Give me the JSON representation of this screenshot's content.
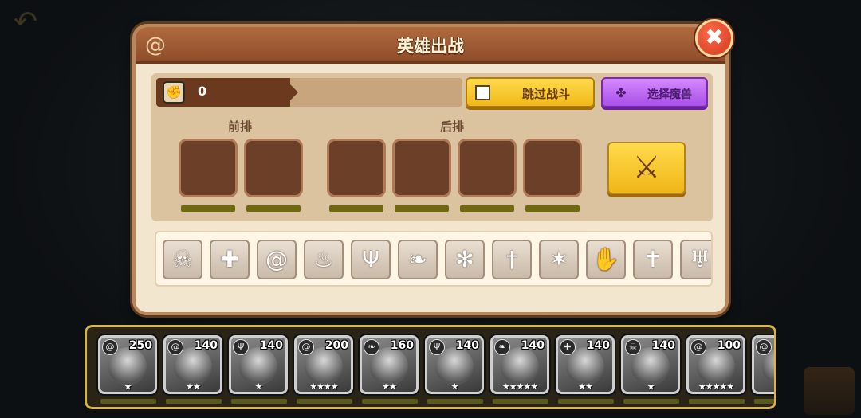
{
  "dialog": {
    "title": "英雄出战",
    "close_symbol": "✖"
  },
  "formation": {
    "power_icon": "fist-icon",
    "power_value": "0",
    "skip_battle": {
      "label": "跳过战斗",
      "checked": false
    },
    "select_beast": {
      "label": "选择魔兽",
      "icon": "paw-icon"
    },
    "front_row_label": "前排",
    "back_row_label": "后排",
    "front_slots": 2,
    "back_slots": 4,
    "battle_button_icon": "crossed-swords-icon"
  },
  "faction_filters": [
    {
      "name": "skull-icon",
      "glyph": "☠"
    },
    {
      "name": "holy-cross-icon",
      "glyph": "✚"
    },
    {
      "name": "swirl-icon",
      "glyph": "@"
    },
    {
      "name": "flame-icon",
      "glyph": "♨"
    },
    {
      "name": "trident-icon",
      "glyph": "Ψ"
    },
    {
      "name": "feather-icon",
      "glyph": "❧"
    },
    {
      "name": "pinwheel-icon",
      "glyph": "✻"
    },
    {
      "name": "sword-icon",
      "glyph": "†"
    },
    {
      "name": "star-burst-icon",
      "glyph": "✶"
    },
    {
      "name": "paw-icon",
      "glyph": "✋"
    },
    {
      "name": "cross-icon",
      "glyph": "✝"
    },
    {
      "name": "demon-icon",
      "glyph": "♅"
    }
  ],
  "heroes": [
    {
      "level": "250",
      "faction_glyph": "@",
      "stars": "★"
    },
    {
      "level": "140",
      "faction_glyph": "@",
      "stars": "★★"
    },
    {
      "level": "140",
      "faction_glyph": "Ψ",
      "stars": "★"
    },
    {
      "level": "200",
      "faction_glyph": "@",
      "stars": "★★★★"
    },
    {
      "level": "160",
      "faction_glyph": "❧",
      "stars": "★★"
    },
    {
      "level": "140",
      "faction_glyph": "Ψ",
      "stars": "★"
    },
    {
      "level": "140",
      "faction_glyph": "❧",
      "stars": "★★★★★"
    },
    {
      "level": "140",
      "faction_glyph": "✚",
      "stars": "★★"
    },
    {
      "level": "140",
      "faction_glyph": "☠",
      "stars": "★"
    },
    {
      "level": "100",
      "faction_glyph": "@",
      "stars": "★★★★★"
    },
    {
      "level": "",
      "faction_glyph": "@",
      "stars": ""
    }
  ],
  "colors": {
    "dialog_bg": "#f3e6cf",
    "header": "#9b5a33",
    "skip_button": "#f6c52a",
    "beast_button": "#b865f0",
    "close_button": "#e04a2a",
    "tray_border": "#d8b24a"
  }
}
